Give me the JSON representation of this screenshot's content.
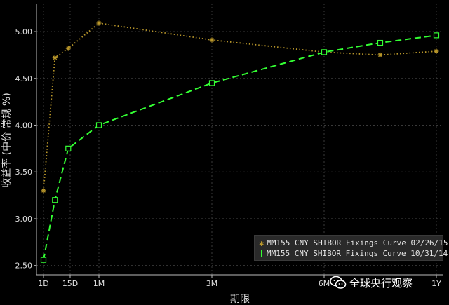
{
  "chart_data": {
    "type": "line",
    "xlabel": "期限",
    "ylabel": "收益率 (中价 常规 %)",
    "ylim": [
      2.4,
      5.3
    ],
    "yticks": [
      "2.50",
      "3.00",
      "3.50",
      "4.00",
      "4.50",
      "5.00"
    ],
    "x_tenor_days": [
      1,
      7,
      14,
      30,
      90,
      180,
      270,
      360
    ],
    "xtick_labels": [
      {
        "label": "1D",
        "days": 1
      },
      {
        "label": "15D",
        "days": 15
      },
      {
        "label": "1M",
        "days": 30
      },
      {
        "label": "3M",
        "days": 90
      },
      {
        "label": "6M",
        "days": 180
      },
      {
        "label": "1Y",
        "days": 360
      }
    ],
    "grid": true,
    "legend_position": "bottom-right",
    "series": [
      {
        "name": "MM155 CNY SHIBOR Fixings Curve 02/26/15",
        "color": "#b8962a",
        "style": "dotted",
        "marker": "star",
        "values": [
          3.3,
          4.72,
          4.82,
          5.09,
          4.91,
          4.78,
          4.75,
          4.79
        ]
      },
      {
        "name": "MM155 CNY SHIBOR Fixings Curve 10/31/14",
        "color": "#33ff33",
        "style": "dashed",
        "marker": "square",
        "values": [
          2.56,
          3.2,
          3.75,
          4.0,
          4.45,
          4.78,
          4.88,
          4.96
        ]
      }
    ]
  },
  "legend": {
    "items": [
      {
        "label": "MM155 CNY SHIBOR Fixings Curve 02/26/15"
      },
      {
        "label": "MM155 CNY SHIBOR Fixings Curve 10/31/14"
      }
    ]
  },
  "watermark": {
    "text": "全球央行观察",
    "icon": "wechat-icon"
  }
}
